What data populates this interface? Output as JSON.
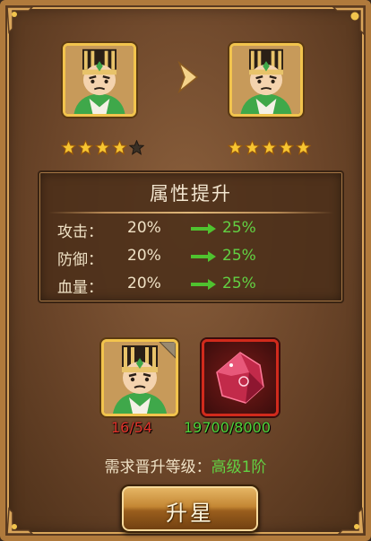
{
  "panel": {
    "frame_color": "#b07a3c"
  },
  "upgrade": {
    "current_hero_icon": "hero-portrait-icon",
    "next_hero_icon": "hero-portrait-icon",
    "current_stars": 4,
    "next_stars": 5,
    "max_stars": 5
  },
  "attributes": {
    "title": "属性提升",
    "rows": [
      {
        "label": "攻击：",
        "base": "20%",
        "new": "25%"
      },
      {
        "label": "防御：",
        "base": "20%",
        "new": "25%"
      },
      {
        "label": "血量：",
        "base": "20%",
        "new": "25%"
      }
    ]
  },
  "materials": {
    "hero_count": "16/54",
    "gem_count": "19700/8000",
    "hero_icon": "hero-shard-icon",
    "gem_icon": "red-gem-icon"
  },
  "requirement": {
    "label": "需求晋升等级：",
    "value": "高级1阶"
  },
  "button": {
    "label": "升星"
  },
  "colors": {
    "green": "#62d143",
    "red": "#e0322a",
    "gold": "#f2c44d"
  }
}
